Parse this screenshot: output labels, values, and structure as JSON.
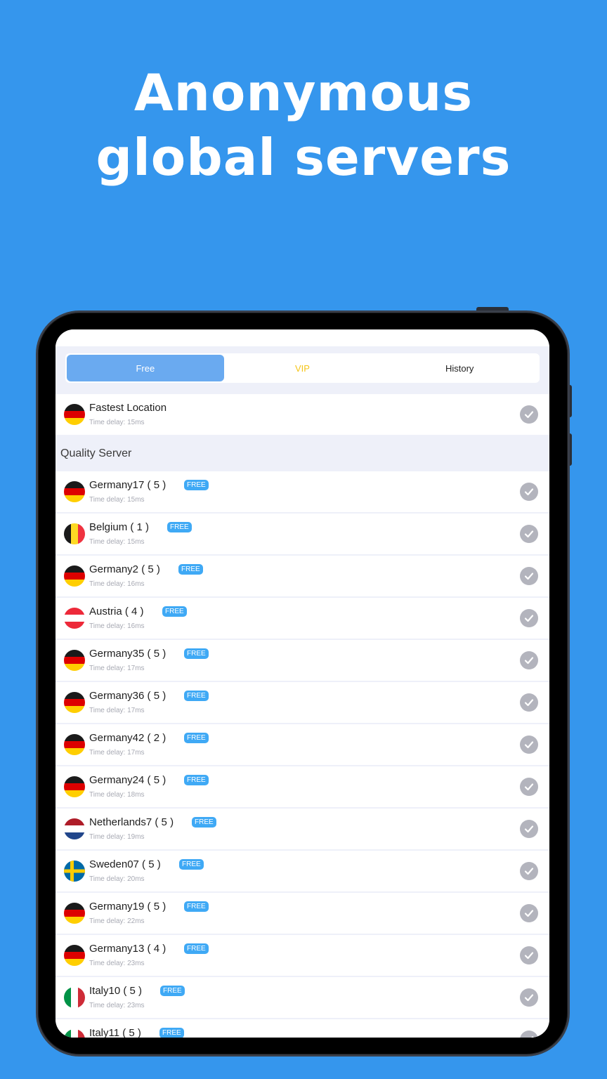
{
  "headline": {
    "line1": "Anonymous",
    "line2": "global servers"
  },
  "tabs": [
    {
      "label": "Free",
      "active": true
    },
    {
      "label": "VIP",
      "active": false
    },
    {
      "label": "History",
      "active": false
    }
  ],
  "fastest": {
    "name": "Fastest Location",
    "delay": "Time delay: 15ms",
    "flag": "germany-flag"
  },
  "section_title": "Quality Server",
  "badge_label": "FREE",
  "servers": [
    {
      "name": "Germany17 ( 5 )",
      "delay": "Time delay: 15ms",
      "flag": "de"
    },
    {
      "name": "Belgium ( 1 )",
      "delay": "Time delay: 15ms",
      "flag": "be"
    },
    {
      "name": "Germany2 ( 5 )",
      "delay": "Time delay: 16ms",
      "flag": "de"
    },
    {
      "name": "Austria ( 4 )",
      "delay": "Time delay: 16ms",
      "flag": "at"
    },
    {
      "name": "Germany35 ( 5 )",
      "delay": "Time delay: 17ms",
      "flag": "de"
    },
    {
      "name": "Germany36 ( 5 )",
      "delay": "Time delay: 17ms",
      "flag": "de"
    },
    {
      "name": "Germany42 ( 2 )",
      "delay": "Time delay: 17ms",
      "flag": "de"
    },
    {
      "name": "Germany24 ( 5 )",
      "delay": "Time delay: 18ms",
      "flag": "de"
    },
    {
      "name": "Netherlands7 ( 5 )",
      "delay": "Time delay: 19ms",
      "flag": "nl"
    },
    {
      "name": "Sweden07 ( 5 )",
      "delay": "Time delay: 20ms",
      "flag": "se"
    },
    {
      "name": "Germany19 ( 5 )",
      "delay": "Time delay: 22ms",
      "flag": "de"
    },
    {
      "name": "Germany13 ( 4 )",
      "delay": "Time delay: 23ms",
      "flag": "de"
    },
    {
      "name": "Italy10 ( 5 )",
      "delay": "Time delay: 23ms",
      "flag": "it"
    },
    {
      "name": "Italy11 ( 5 )",
      "delay": "",
      "flag": "it"
    }
  ],
  "colors": {
    "background": "#3596ED",
    "badge": "#3fa9f5",
    "vip": "#f5c518",
    "active_tab": "#6aaaf0"
  }
}
